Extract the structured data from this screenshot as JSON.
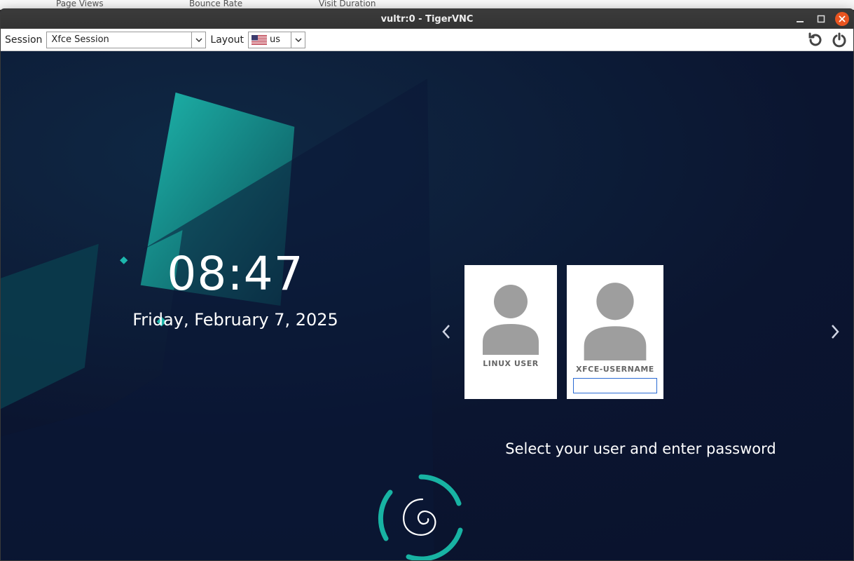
{
  "host_fragments": {
    "a": "Page Views",
    "b": "Bounce Rate",
    "c": "Visit Duration"
  },
  "window": {
    "title": "vultr:0 - TigerVNC"
  },
  "toolbar": {
    "session_label": "Session",
    "session_value": "Xfce Session",
    "layout_label": "Layout",
    "layout_value": "us"
  },
  "clock": {
    "time": "08:47",
    "date": "Friday, February 7, 2025"
  },
  "users": [
    {
      "name": "LINUX USER"
    },
    {
      "name": "XFCE-USERNAME"
    }
  ],
  "password_value": "",
  "hint": "Select your user and enter password"
}
